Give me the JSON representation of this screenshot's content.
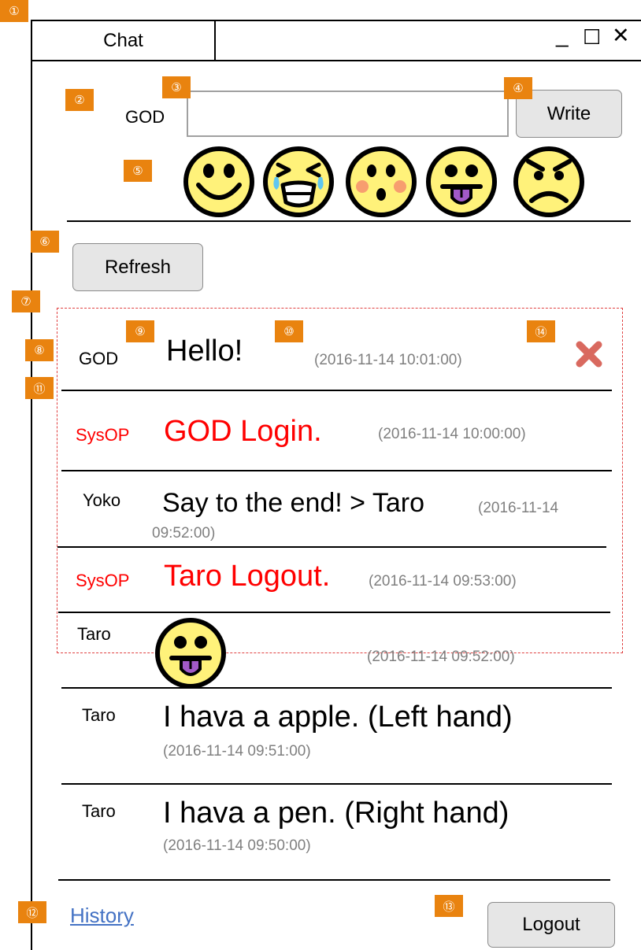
{
  "window": {
    "tab_title": "Chat",
    "minimize": "_",
    "maximize": "☐",
    "close": "✕"
  },
  "badges": [
    "①",
    "②",
    "③",
    "④",
    "⑤",
    "⑥",
    "⑦",
    "⑧",
    "⑨",
    "⑩",
    "⑪",
    "⑫",
    "⑬",
    "⑭"
  ],
  "compose": {
    "username": "GOD",
    "input_value": "",
    "write_label": "Write",
    "emoticons": [
      "smile-emoticon",
      "crying-laughing-emoticon",
      "surprised-blush-emoticon",
      "tongue-out-emoticon",
      "angry-emoticon"
    ]
  },
  "refresh_label": "Refresh",
  "messages": [
    {
      "user": "GOD",
      "text": "Hello!",
      "time": "(2016-11-14 10:01:00)",
      "system": false,
      "deletable": true
    },
    {
      "user": "SysOP",
      "text": "GOD Login.",
      "time": "(2016-11-14 10:00:00)",
      "system": true
    },
    {
      "user": "Yoko",
      "text": "Say to the end! > Taro",
      "time_part1": "(2016-11-14",
      "time_part2": "09:52:00)",
      "system": false
    },
    {
      "user": "SysOP",
      "text": "Taro Logout.",
      "time": "(2016-11-14 09:53:00)",
      "system": true
    },
    {
      "user": "Taro",
      "emoticon": "tongue-out-emoticon",
      "time": "(2016-11-14 09:52:00)",
      "system": false
    },
    {
      "user": "Taro",
      "text": "I hava a apple. (Left hand)",
      "time": "(2016-11-14 09:51:00)",
      "system": false
    },
    {
      "user": "Taro",
      "text": "I hava a pen. (Right hand)",
      "time": "(2016-11-14 09:50:00)",
      "system": false
    }
  ],
  "footer": {
    "history_label": "History",
    "logout_label": "Logout"
  },
  "colors": {
    "badge": "#E9830F",
    "system_text": "#FF0000",
    "timestamp": "#7F7F7F",
    "link": "#4472C4",
    "emoji_fill": "#FFF27A",
    "delete_x": "#D9695F"
  }
}
